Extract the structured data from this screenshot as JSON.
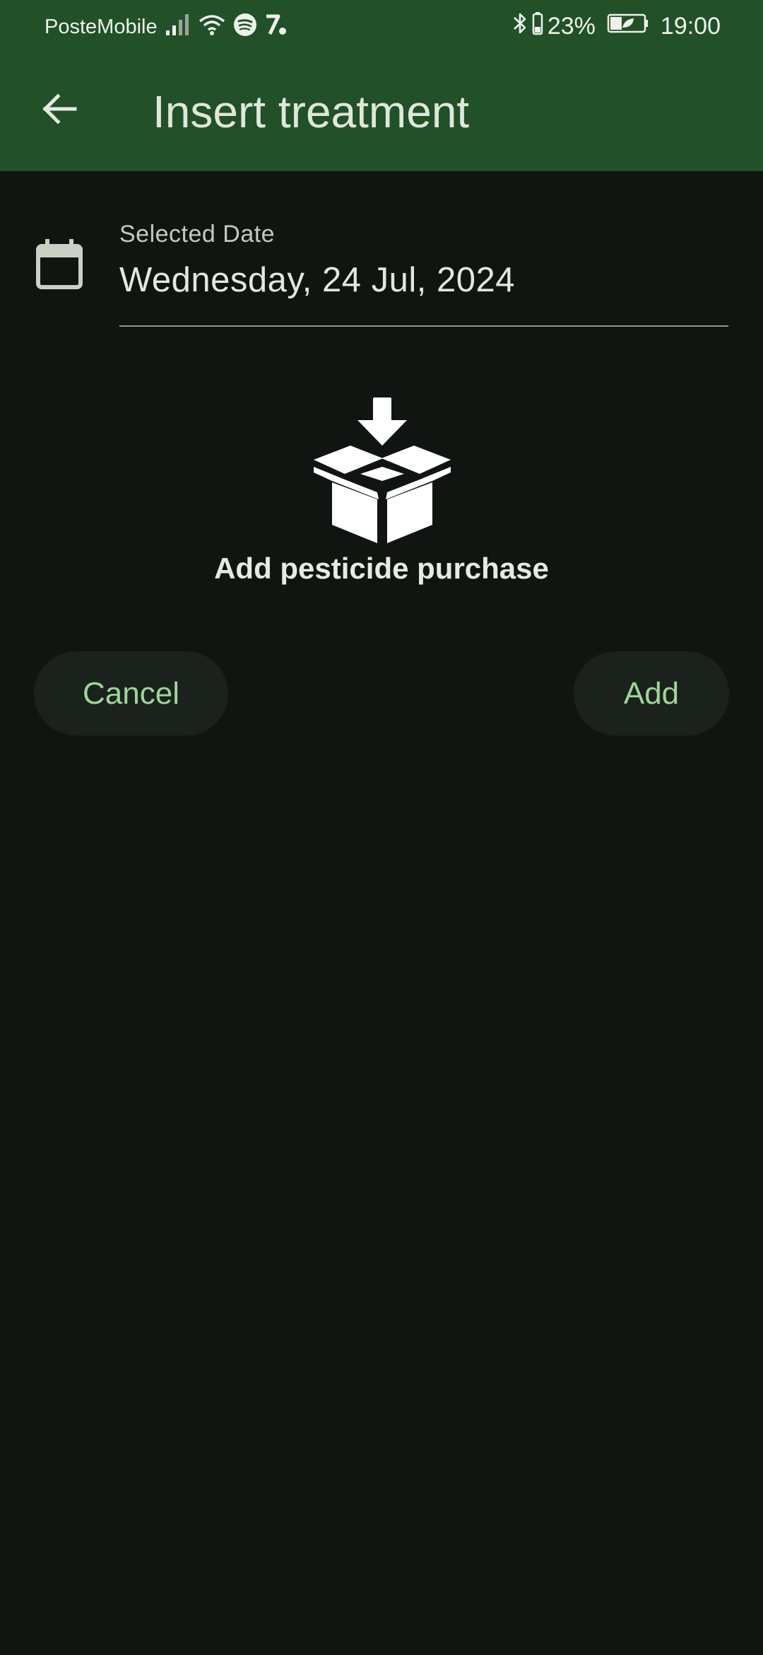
{
  "status_bar": {
    "carrier": "PosteMobile",
    "battery_percent": "23%",
    "time": "19:00",
    "icons": [
      "signal-icon",
      "wifi-icon",
      "spotify-icon",
      "app-notification-icon",
      "bluetooth-icon",
      "battery-icon",
      "battery-saver-icon"
    ]
  },
  "app_bar": {
    "title": "Insert treatment",
    "back_icon": "arrow-left-icon"
  },
  "date_field": {
    "label": "Selected Date",
    "value": "Wednesday, 24 Jul, 2024",
    "icon": "calendar-icon"
  },
  "purchase": {
    "icon": "box-download-icon",
    "label": "Add pesticide purchase"
  },
  "actions": {
    "cancel_label": "Cancel",
    "add_label": "Add"
  },
  "colors": {
    "app_bar": "#225028",
    "background": "#101511",
    "button_text": "#9fd49a",
    "button_bg": "#1b211c"
  }
}
